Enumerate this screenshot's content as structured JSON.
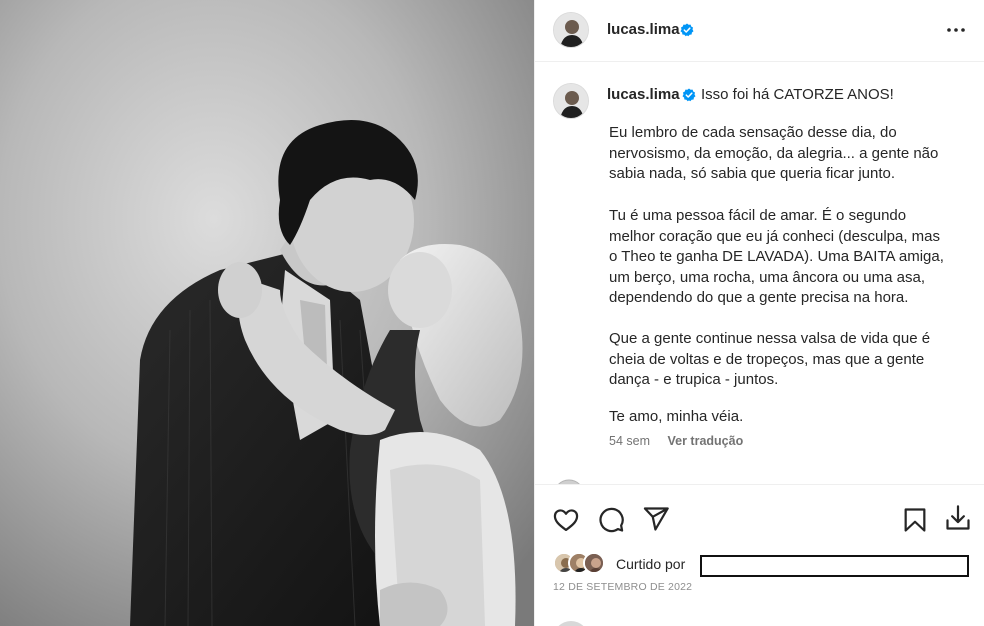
{
  "post": {
    "username": "lucas.lima",
    "verified_icon": "verified-badge-icon",
    "more_icon": "more-options-icon"
  },
  "caption": {
    "username": "lucas.lima",
    "first_line": "Isso foi há CATORZE ANOS!",
    "paragraphs": [
      [
        "Eu lembro de cada sensação desse dia, do",
        "nervosismo, da emoção, da alegria... a gente não",
        "sabia nada, só sabia que queria ficar junto."
      ],
      [
        "Tu é uma pessoa fácil de amar. É o segundo",
        "melhor coração que eu já conheci (desculpa, mas",
        "o Theo te ganha DE LAVADA). Uma BAITA amiga,",
        "um berço, uma rocha, uma âncora ou uma asa,",
        "dependendo do que a gente precisa na hora."
      ],
      [
        "Que a gente continue nessa valsa de vida que é",
        "cheia de voltas e de tropeços, mas que a gente",
        "dança - e trupica - juntos."
      ],
      [
        "Te amo, minha véia."
      ]
    ],
    "time_ago": "54 sem",
    "translate_label": "Ver tradução"
  },
  "actions": {
    "like_icon": "heart-icon",
    "comment_icon": "comment-icon",
    "share_icon": "share-icon",
    "save_icon": "bookmark-icon",
    "download_icon": "download-icon"
  },
  "likes": {
    "label": "Curtido por"
  },
  "date": "12 DE SETEMBRO DE 2022"
}
